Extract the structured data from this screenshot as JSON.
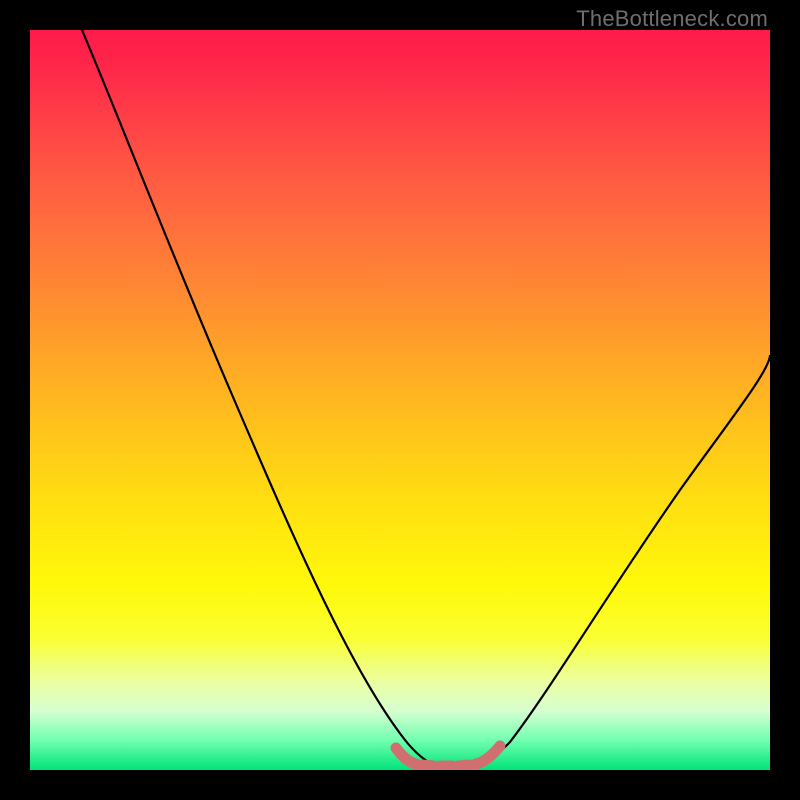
{
  "watermark": {
    "text": "TheBottleneck.com"
  },
  "chart_data": {
    "type": "line",
    "title": "",
    "xlabel": "",
    "ylabel": "",
    "xlim": [
      0,
      100
    ],
    "ylim": [
      0,
      100
    ],
    "background_gradient": {
      "direction": "top_to_bottom",
      "stops": [
        {
          "pos": 0.0,
          "color": "#ff1a4a"
        },
        {
          "pos": 0.5,
          "color": "#ffc61a"
        },
        {
          "pos": 0.8,
          "color": "#fff80a"
        },
        {
          "pos": 1.0,
          "color": "#00e37a"
        }
      ]
    },
    "series": [
      {
        "name": "bottleneck_curve",
        "color": "#000000",
        "x": [
          7,
          12,
          18,
          24,
          30,
          36,
          42,
          48,
          52,
          55,
          58,
          62,
          65,
          70,
          76,
          82,
          88,
          94,
          100
        ],
        "y": [
          100,
          88,
          74,
          60,
          46,
          32,
          18,
          6,
          2,
          1,
          1,
          2,
          4,
          10,
          20,
          32,
          42,
          50,
          56
        ]
      },
      {
        "name": "optimal_band",
        "color": "#d46a6a",
        "style": "thick_dotted",
        "x": [
          50,
          52,
          54,
          56,
          58,
          60,
          62,
          64
        ],
        "y": [
          3,
          1.5,
          1,
          1,
          1,
          1,
          1.5,
          3
        ]
      }
    ],
    "annotations": [],
    "legend": []
  }
}
